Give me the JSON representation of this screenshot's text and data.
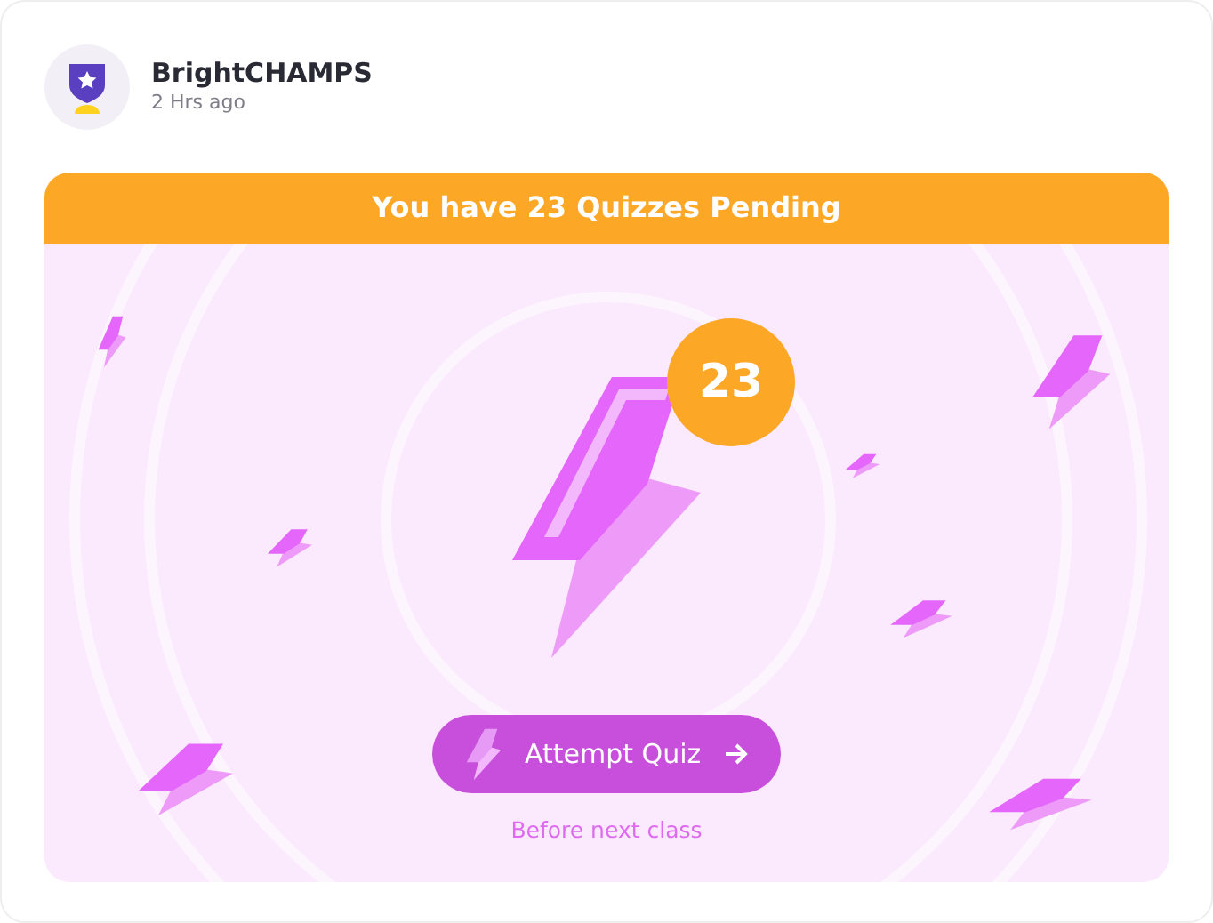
{
  "post": {
    "author": "BrightCHAMPS",
    "time": "2 Hrs ago"
  },
  "quiz_card": {
    "banner": "You have 23 Quizzes Pending",
    "count_badge": "23",
    "button": "Attempt Quiz",
    "note": "Before next class"
  }
}
